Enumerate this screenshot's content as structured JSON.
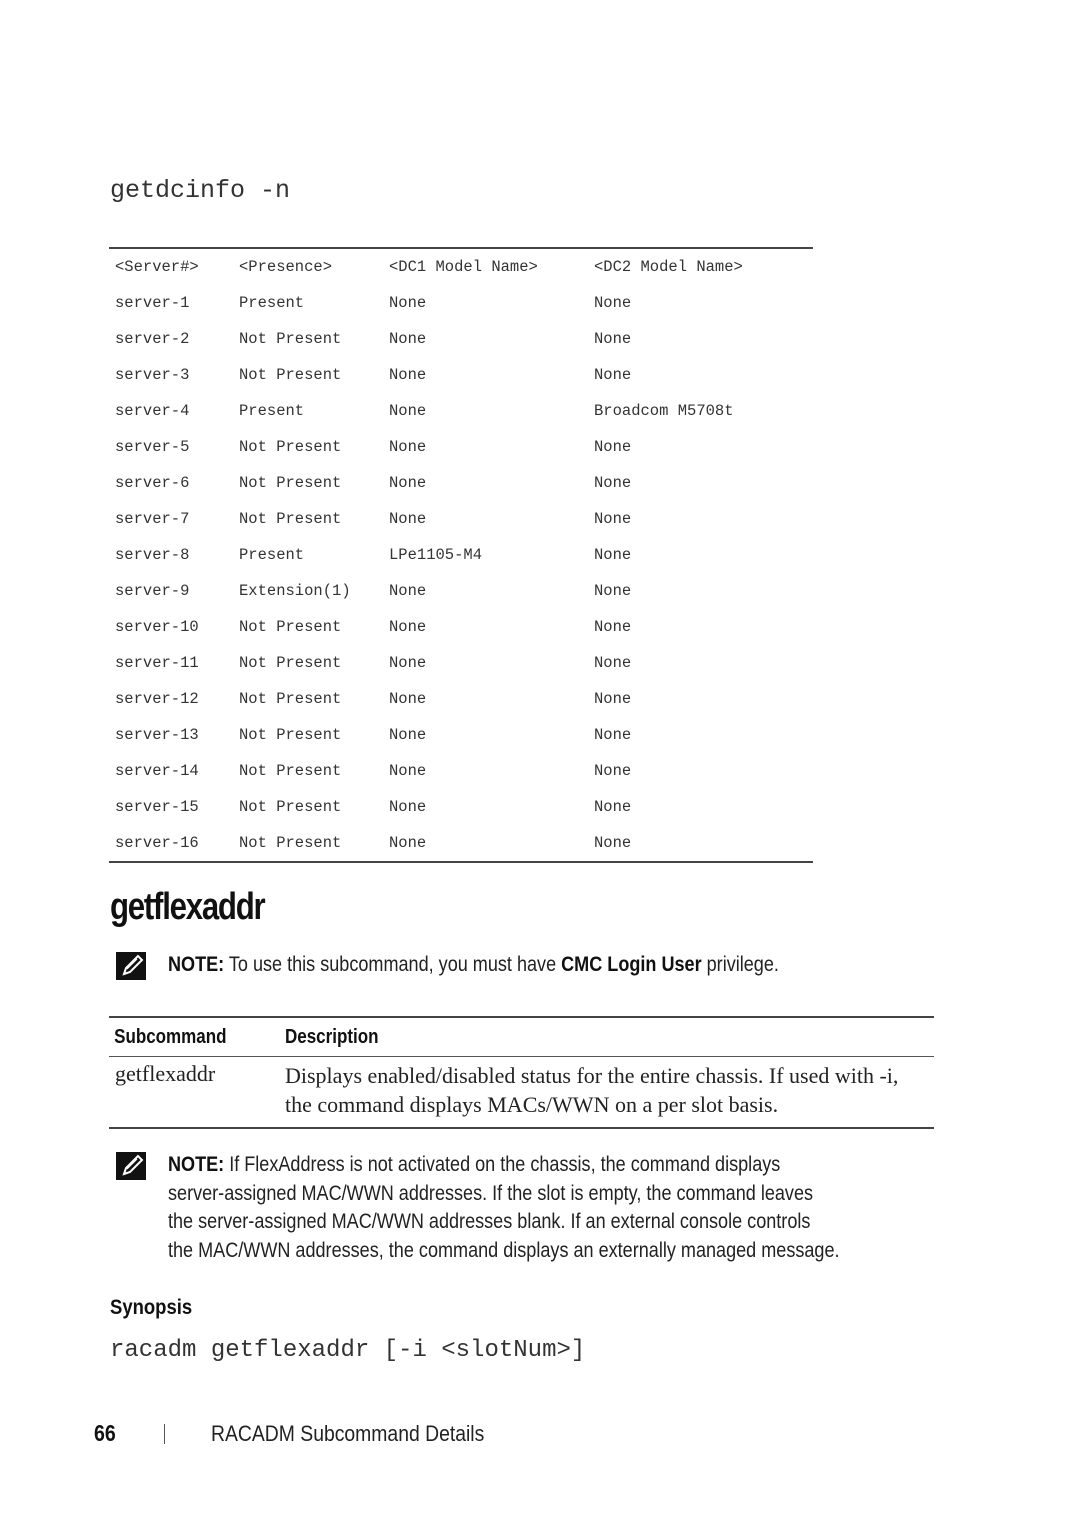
{
  "code_heading": "getdcinfo -n",
  "dc_table": {
    "headers": [
      "<Server#>",
      "<Presence>",
      "<DC1 Model Name>",
      "<DC2 Model Name>"
    ],
    "rows": [
      [
        "server-1",
        "Present",
        "None",
        "None"
      ],
      [
        "server-2",
        "Not Present",
        "None",
        "None"
      ],
      [
        "server-3",
        "Not Present",
        "None",
        "None"
      ],
      [
        "server-4",
        "Present",
        "None",
        "Broadcom M5708t"
      ],
      [
        "server-5",
        "Not Present",
        "None",
        "None"
      ],
      [
        "server-6",
        "Not Present",
        "None",
        "None"
      ],
      [
        "server-7",
        "Not Present",
        "None",
        "None"
      ],
      [
        "server-8",
        "Present",
        "LPe1105-M4",
        "None"
      ],
      [
        "server-9",
        "Extension(1)",
        "None",
        "None"
      ],
      [
        "server-10",
        "Not Present",
        "None",
        "None"
      ],
      [
        "server-11",
        "Not Present",
        "None",
        "None"
      ],
      [
        "server-12",
        "Not Present",
        "None",
        "None"
      ],
      [
        "server-13",
        "Not Present",
        "None",
        "None"
      ],
      [
        "server-14",
        "Not Present",
        "None",
        "None"
      ],
      [
        "server-15",
        "Not Present",
        "None",
        "None"
      ],
      [
        "server-16",
        "Not Present",
        "None",
        "None"
      ]
    ]
  },
  "section_title": "getflexaddr",
  "note1": {
    "icon": "note-pencil-icon",
    "label": "NOTE:",
    "text_before": " To use this subcommand, you must have ",
    "bold": "CMC Login User",
    "text_after": " privilege."
  },
  "desc_table": {
    "headers": [
      "Subcommand",
      "Description"
    ],
    "rows": [
      {
        "subcommand": "getflexaddr",
        "description": "Displays enabled/disabled status for the entire chassis. If used with -i, the command displays MACs/WWN on a per slot basis."
      }
    ]
  },
  "note2": {
    "icon": "note-pencil-icon",
    "label": "NOTE:",
    "lines": [
      " If FlexAddress is not activated on the chassis, the command displays",
      "server-assigned MAC/WWN addresses. If the slot is empty, the command leaves",
      "the server-assigned MAC/WWN addresses blank. If an external console controls",
      "the MAC/WWN addresses, the command displays an externally managed message."
    ]
  },
  "synopsis": {
    "label": "Synopsis",
    "code": "racadm getflexaddr [-i <slotNum>]"
  },
  "footer": {
    "page_number": "66",
    "separator": "|",
    "chapter_title": "RACADM Subcommand Details"
  }
}
